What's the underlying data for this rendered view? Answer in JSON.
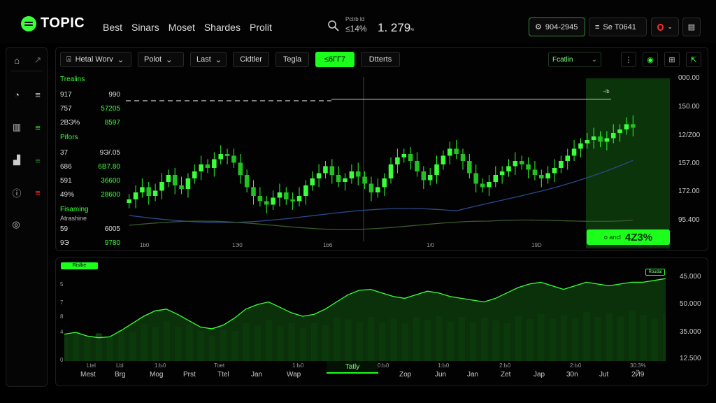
{
  "app": {
    "title": "TOPIC"
  },
  "nav": [
    "Best",
    "Sinars",
    "Moset",
    "Shardes",
    "Prolit"
  ],
  "ticker": {
    "label": "Pctrb ld",
    "change": "≤14%",
    "price": "1. 279",
    "price_unit": "≈"
  },
  "header_buttons": {
    "account": "904-2945",
    "sort": "Se T0641"
  },
  "toolbar": {
    "symbol": "Hetal Worv",
    "items": [
      "Polot",
      "Last",
      "Cidtler",
      "Tegla",
      "≤6ГГ7",
      "Dtterts"
    ],
    "active_index": 4,
    "right_select": "Fcatlin"
  },
  "watchlist": {
    "sections": [
      {
        "title": "Trealins",
        "rows": [
          [
            "917",
            "990",
            false
          ],
          [
            "757",
            "57205",
            true
          ],
          [
            "2BЭ%",
            "8597",
            true
          ]
        ]
      },
      {
        "title": "Pifors",
        "rows": [
          [
            "37",
            "9Э/.05",
            false
          ],
          [
            "686",
            "6B7.80",
            true
          ],
          [
            "591",
            "36600",
            true
          ],
          [
            "49%",
            "28600",
            true
          ]
        ]
      },
      {
        "title": "Fisaming",
        "sub": "Atrashine",
        "rows": [
          [
            "59",
            "6005",
            false
          ],
          [
            "9Э",
            "9780",
            true
          ]
        ]
      }
    ]
  },
  "main_chart": {
    "y_labels": [
      "000.00",
      "150.00",
      "12/Z00",
      "157.00",
      "172.00",
      "95.400"
    ],
    "x_labels": [
      "1b0",
      "1Э0",
      "1b6",
      "1/0",
      "19D"
    ],
    "highlight": {
      "label": "o ancl",
      "value": "4Z3%"
    },
    "tag": "~lb"
  },
  "lower_chart": {
    "badge": "Rislbe",
    "right_badge": "Roudal",
    "y_labels": [
      "45.000",
      "50.000",
      "35.000",
      "12.500"
    ],
    "y_left": [
      "5",
      "7",
      "8",
      "4",
      "0"
    ],
    "x_top": [
      "Ltel",
      "Lbl",
      "1:Ь0",
      "Toet",
      "1:Ь0",
      "Tatly",
      "0:Ь0",
      "1:Ь0",
      "2:Ь0",
      "2:Ь0",
      "30:3%"
    ],
    "x_bottom": [
      "Mest",
      "Brg",
      "Mog",
      "Prst",
      "Ttel",
      "Jan",
      "Wap",
      "Zop",
      "Jun",
      "Jan",
      "Zet",
      "Jap",
      "30n",
      "Jut",
      "2Й9"
    ],
    "selected": "Tatly"
  },
  "chart_data": {
    "type": "line",
    "ohlc_closes": [
      58,
      62,
      65,
      60,
      63,
      68,
      72,
      66,
      64,
      70,
      74,
      78,
      76,
      81,
      84,
      83,
      79,
      72,
      65,
      60,
      57,
      55,
      59,
      62,
      58,
      57,
      60,
      66,
      70,
      73,
      77,
      72,
      68,
      70,
      74,
      71,
      67,
      62,
      65,
      70,
      78,
      82,
      84,
      80,
      74,
      69,
      72,
      78,
      83,
      87,
      84,
      80,
      73,
      67,
      65,
      68,
      72,
      74,
      77,
      80,
      78,
      75,
      72,
      70,
      73,
      76,
      80,
      83,
      87,
      90,
      92,
      94,
      91,
      93,
      96,
      98,
      101,
      99
    ],
    "lower_line": [
      30,
      32,
      28,
      26,
      27,
      34,
      42,
      50,
      56,
      58,
      52,
      45,
      38,
      36,
      40,
      48,
      58,
      63,
      66,
      60,
      54,
      50,
      52,
      58,
      66,
      74,
      79,
      80,
      76,
      72,
      70,
      74,
      78,
      76,
      72,
      70,
      68,
      66,
      70,
      76,
      82,
      86,
      88,
      84,
      80,
      84,
      88,
      86,
      84,
      86,
      88,
      88,
      90,
      92
    ]
  }
}
